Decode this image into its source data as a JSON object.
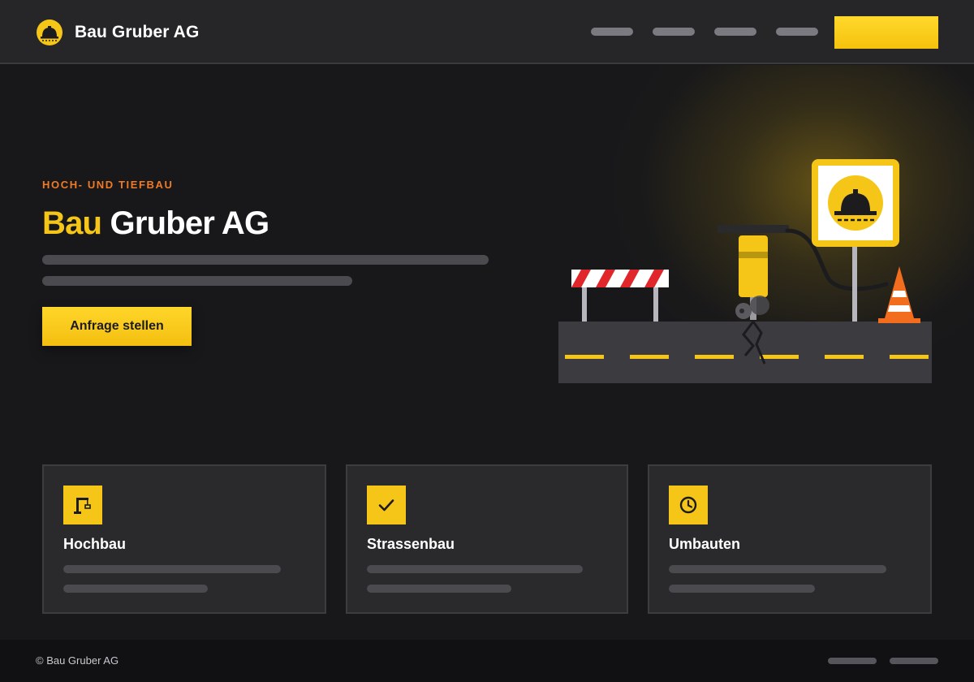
{
  "header": {
    "brand": "Bau Gruber AG",
    "logo_icon": "hardhat-logo-icon",
    "nav_links": [
      "",
      "",
      "",
      ""
    ],
    "cta_label": ""
  },
  "hero": {
    "eyebrow": "HOCH- UND TIEFBAU",
    "title_accent": "Bau",
    "title_rest": "Gruber AG",
    "cta_label": "Anfrage stellen",
    "illustration_icons": [
      "barrier-icon",
      "jackhammer-icon",
      "hardhat-sign-icon",
      "traffic-cone-icon",
      "road-icon"
    ]
  },
  "services": [
    {
      "icon": "crane-icon",
      "title": "Hochbau"
    },
    {
      "icon": "check-icon",
      "title": "Strassenbau"
    },
    {
      "icon": "clock-icon",
      "title": "Umbauten"
    }
  ],
  "footer": {
    "copyright": "© Bau Gruber AG",
    "links": [
      "",
      ""
    ]
  },
  "colors": {
    "accent": "#f5c518",
    "eyebrow": "#f07a26",
    "background": "#18181a",
    "surface": "#2a2a2d",
    "cone": "#f36d1f",
    "barrier_red": "#e0262b"
  }
}
